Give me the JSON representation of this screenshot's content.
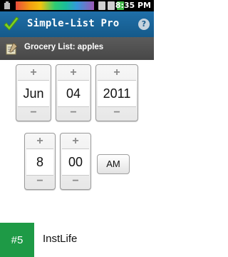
{
  "status_bar": {
    "time": "8:35 PM"
  },
  "header": {
    "title": "Simple-List Pro",
    "help_glyph": "?"
  },
  "sub_header": {
    "title": "Grocery List: apples"
  },
  "date": {
    "month": "Jun",
    "day": "04",
    "year": "2011"
  },
  "time_picker": {
    "hour": "8",
    "minute": "00",
    "ampm": "AM"
  },
  "spinner_glyphs": {
    "up": "+",
    "down": "−"
  },
  "footer": {
    "rank": "#5",
    "app_name": "InstLife"
  },
  "colors": {
    "title_bar": "#1a65a0",
    "sub_header": "#4f4f4f",
    "rank_badge": "#1e9a46",
    "check_icon": "#7ed321"
  }
}
